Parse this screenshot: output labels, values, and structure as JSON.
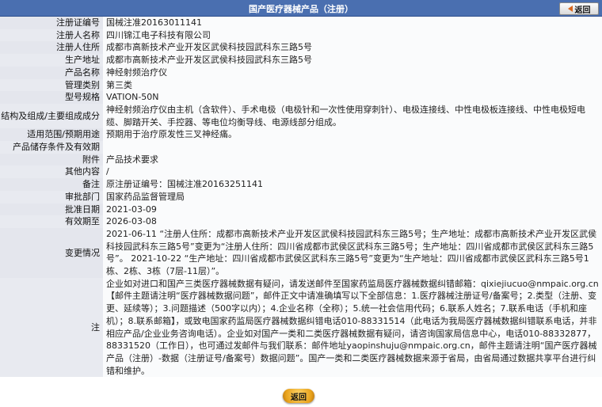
{
  "header": {
    "title": "国产医疗器械产品（注册）",
    "back_label": "返回"
  },
  "fields": [
    {
      "label": "注册证编号",
      "value": "国械注准20163011141"
    },
    {
      "label": "注册人名称",
      "value": "四川锦江电子科技有限公司"
    },
    {
      "label": "注册人住所",
      "value": "成都市高新技术产业开发区武侯科技园武科东三路5号"
    },
    {
      "label": "生产地址",
      "value": "成都市高新技术产业开发区武侯科技园武科东三路5号"
    },
    {
      "label": "产品名称",
      "value": "神经射频治疗仪"
    },
    {
      "label": "管理类别",
      "value": "第三类"
    },
    {
      "label": "型号规格",
      "value": "VATION-50N"
    },
    {
      "label": "结构及组成/主要组成成分",
      "value": "神经射频治疗仪由主机（含软件）、手术电极（电极针和一次性使用穿刺针）、电极连接线、中性电极板连接线、中性电极短电缆、脚踏开关、手控器、等电位均衡导线、电源线部分组成。"
    },
    {
      "label": "适用范围/预期用途",
      "value": "预期用于治疗原发性三叉神经痛。"
    },
    {
      "label": "产品储存条件及有效期",
      "value": ""
    },
    {
      "label": "附件",
      "value": "产品技术要求"
    },
    {
      "label": "其他内容",
      "value": "/"
    },
    {
      "label": "备注",
      "value": "原注册证编号：国械注准20163251141"
    },
    {
      "label": "审批部门",
      "value": "国家药品监督管理局"
    },
    {
      "label": "批准日期",
      "value": "2021-03-09"
    },
    {
      "label": "有效期至",
      "value": "2026-03-08"
    },
    {
      "label": "变更情况",
      "value": "2021-06-11 “注册人住所：成都市高新技术产业开发区武侯科技园武科东三路5号；生产地址：成都市高新技术产业开发区武侯科技园武科东三路5号”变更为“注册人住所：四川省成都市武侯区武科东三路5号；生产地址：四川省成都市武侯区武科东三路5号”。 2021-10-22 “生产地址：四川省成都市武侯区武科东三路5号”变更为“生产地址：四川省成都市武侯区武科东三路5号1栋、2栋、3栋（7层-11层）”。"
    },
    {
      "label": "注",
      "value": "企业如对进口和国产三类医疗器械数据有疑问，请发送邮件至国家药监局医疗器械数据纠错邮箱：qixiejiucuo@nmpaic.org.cn【邮件主题请注明“医疗器械数据问题”，邮件正文中请准确填写以下全部信息：1.医疗器械注册证号/备案号；2.类型（注册、变更、延续等）；3.问题描述（500字以内）；4.企业名称（全称）；5.统一社会信用代码；6.联系人姓名；7.联系电话（手机和座机）；8.联系邮箱】，或致电国家药监局医疗器械数据纠错电话010-88331514（此电话为我局医疗器械数据纠错联系电话，并非相应产品/企业业务咨询电话）。企业如对国产一类和二类医疗器械数据有疑问，请咨询国家局信息中心，电话010-88332877，88331520（工作日），也可通过发邮件与我们联系：邮件地址yaopinshuju@nmpaic.org.cn，邮件主题请注明“国产医疗器械产品（注册）-数据（注册证号/备案号）数据问题”。国产一类和二类医疗器械数据来源于省局，由省局通过数据共享平台进行纠错和维护。"
    }
  ]
}
